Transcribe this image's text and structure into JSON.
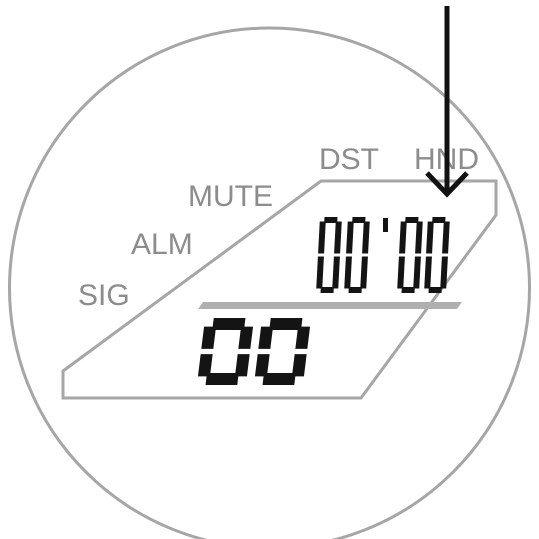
{
  "indicators": {
    "sig": "SIG",
    "alm": "ALM",
    "mute": "MUTE",
    "dst": "DST",
    "hnd": "HND"
  },
  "upper_display": {
    "digits": [
      "0",
      "0",
      "0",
      "0"
    ],
    "separator": "'"
  },
  "lower_display": {
    "digits": [
      "0",
      "0"
    ]
  },
  "arrow": {
    "points_to": "HND"
  },
  "colors": {
    "outline": "#a6a6a6",
    "indicator_text": "#8c8c8c",
    "segments": "#141414",
    "arrow": "#111111"
  },
  "icons": {
    "pointer": "down-arrow-icon"
  }
}
